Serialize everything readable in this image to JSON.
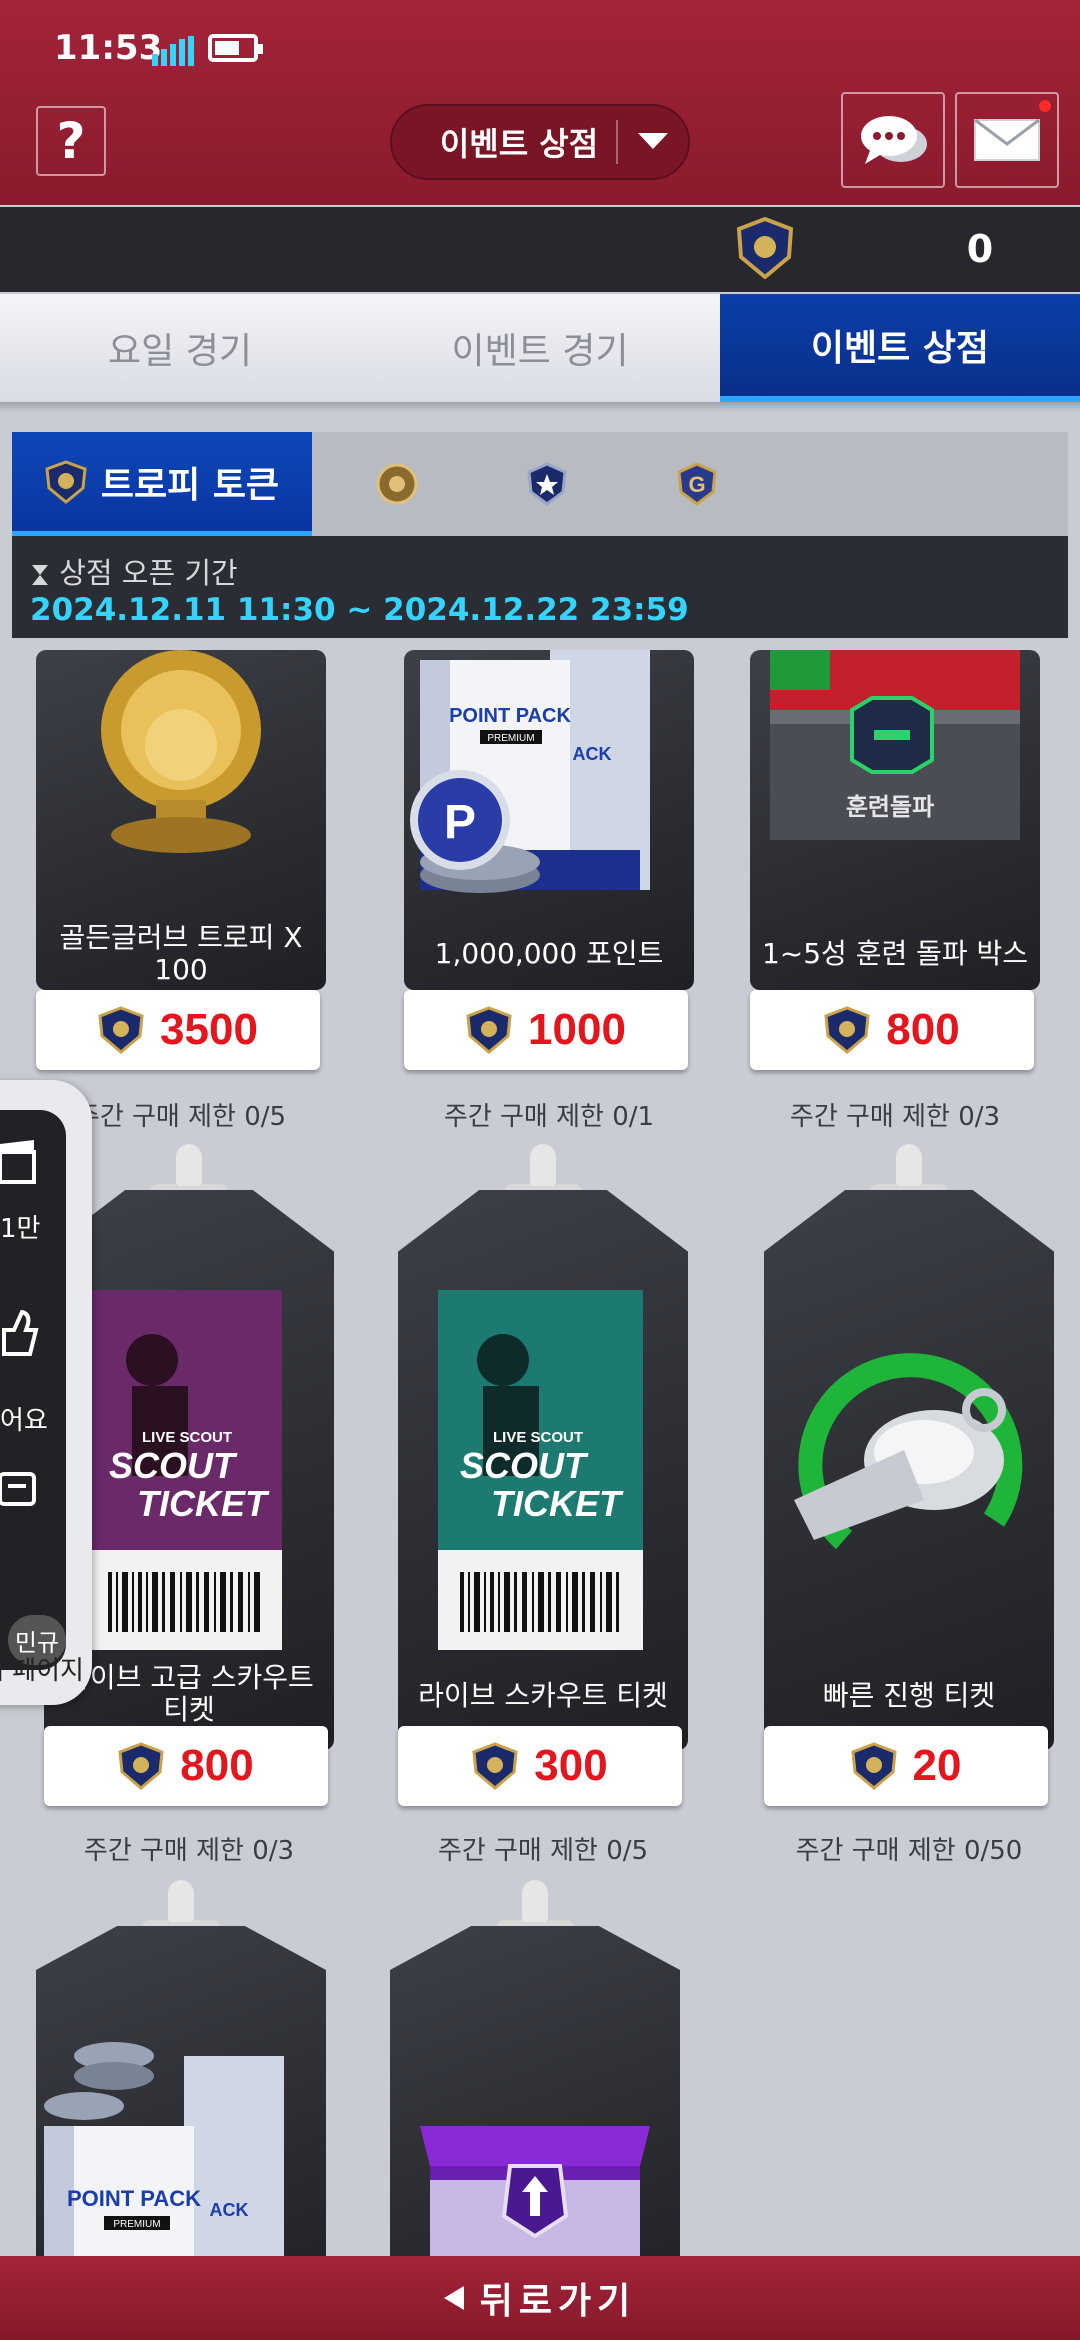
{
  "status": {
    "time": "11:53"
  },
  "header": {
    "help_label": "?",
    "dropdown_label": "이벤트 상점",
    "currency_value": "0"
  },
  "tabs": [
    {
      "label": "요일 경기",
      "active": false
    },
    {
      "label": "이벤트 경기",
      "active": false
    },
    {
      "label": "이벤트 상점",
      "active": true
    }
  ],
  "token_tabs": {
    "active_label": "트로피 토큰"
  },
  "period": {
    "label": "상점 오픈 기간",
    "value": "2024.12.11 11:30 ~ 2024.12.22 23:59"
  },
  "items": [
    {
      "name": "골든글러브 트로피 X 100",
      "price": "3500",
      "limit": "주간 구매 제한 0/5"
    },
    {
      "name": "1,000,000 포인트",
      "price": "1000",
      "limit": "주간 구매 제한 0/1"
    },
    {
      "name": "1~5성 훈련 돌파 박스",
      "price": "800",
      "limit": "주간 구매 제한 0/3"
    },
    {
      "name": "라이브 고급 스카우트 티켓",
      "price": "800",
      "limit": "주간 구매 제한 0/3"
    },
    {
      "name": "라이브 스카우트 티켓",
      "price": "300",
      "limit": "주간 구매 제한 0/5"
    },
    {
      "name": "빠른 진행 티켓",
      "price": "20",
      "limit": "주간 구매 제한 0/50"
    }
  ],
  "art_text": {
    "point_pack": "POINT PACK",
    "premium": "PREMIUM",
    "training": "훈련돌파",
    "live_scout": "LIVE SCOUT",
    "scout": "SCOUT",
    "ticket": "TICKET",
    "ack": "ACK"
  },
  "side_panel": {
    "text1": "1만",
    "text2": "어요",
    "chip": "민규",
    "bottom": "내 페이지"
  },
  "footer": {
    "back_label": "뒤로가기"
  },
  "colors": {
    "header": "#a3243a",
    "active_tab": "#0b3ea8",
    "price": "#e3161e",
    "period": "#35d4ff"
  }
}
